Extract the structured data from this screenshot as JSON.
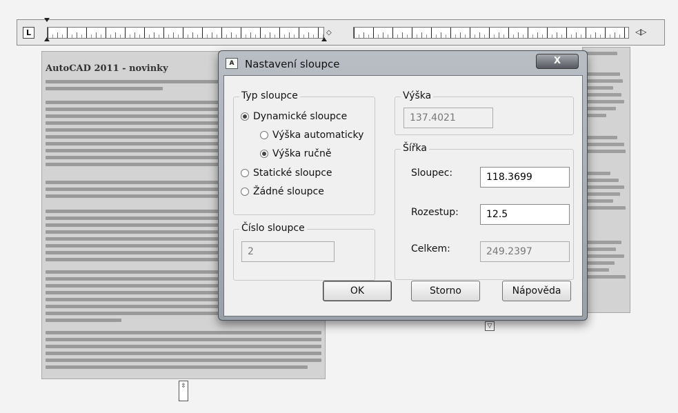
{
  "ruler": {
    "tab_symbol": "L",
    "diamond_symbol": "◇",
    "arrows_symbol": "◁▷"
  },
  "document": {
    "title": "AutoCAD 2011 - novinky",
    "column_arrow_up_down": "⇳",
    "column_arrow_down": "▽"
  },
  "dialog": {
    "title": "Nastavení sloupce",
    "title_icon": "A",
    "close_label": "X",
    "column_type": {
      "label": "Typ sloupce",
      "dynamic_label": "Dynamické sloupce",
      "auto_height_label": "Výška automaticky",
      "manual_height_label": "Výška ručně",
      "static_label": "Statické sloupce",
      "none_label": "Žádné sloupce",
      "selected": "Dynamické sloupce",
      "selected_height_mode": "Výška ručně"
    },
    "column_number": {
      "label": "Číslo sloupce",
      "value": "2"
    },
    "height": {
      "label": "Výška",
      "value": "137.4021"
    },
    "width": {
      "label": "Šířka",
      "column_label": "Sloupec:",
      "column_value": "118.3699",
      "gutter_label": "Rozestup:",
      "gutter_value": "12.5",
      "total_label": "Celkem:",
      "total_value": "249.2397"
    },
    "buttons": {
      "ok": "OK",
      "cancel": "Storno",
      "help": "Nápověda"
    }
  },
  "colors": {
    "dialog_client": "#f0f0f0",
    "dialog_frame": "#a9aeb5",
    "document_page": "#d3d3d3"
  }
}
